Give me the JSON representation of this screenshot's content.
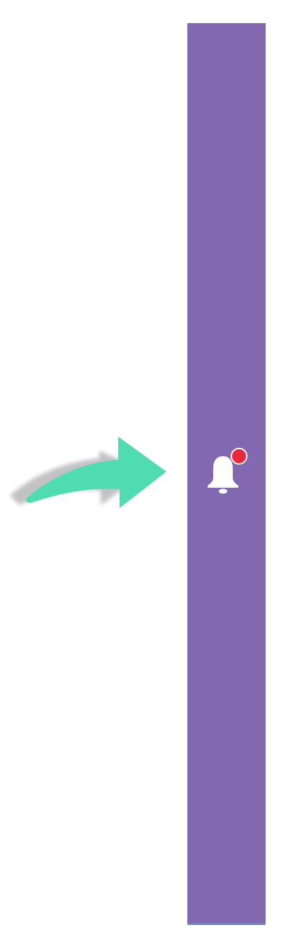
{
  "page": {
    "background": "#ffffff"
  },
  "side_panel": {
    "color": "#8168b0",
    "bottom_edge_color": "#6d86c4",
    "notification": {
      "icon": "bell-icon",
      "has_unread_badge": true,
      "badge_color": "#e8283f"
    }
  },
  "annotation": {
    "icon": "curved-arrow-right-icon",
    "color": "#4fdcb1"
  }
}
